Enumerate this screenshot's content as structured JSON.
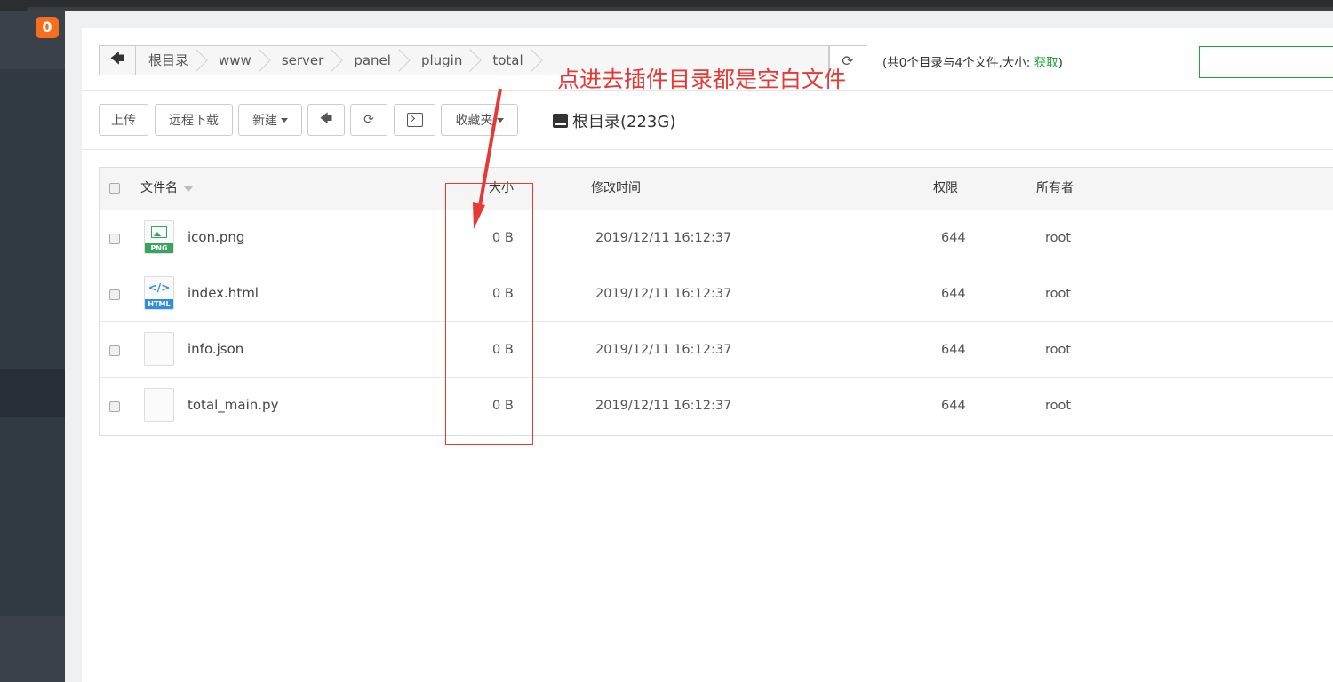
{
  "sidebar": {
    "badge_count": "0"
  },
  "path": {
    "crumbs": [
      "根目录",
      "www",
      "server",
      "panel",
      "plugin",
      "total"
    ]
  },
  "summary": {
    "text": "(共0个目录与4个文件,大小: ",
    "fetch": "获取",
    "close": ")"
  },
  "toolbar": {
    "upload": "上传",
    "remote_download": "远程下载",
    "new": "新建",
    "favorites": "收藏夹",
    "disk": "根目录(223G)"
  },
  "table": {
    "headers": {
      "name": "文件名",
      "size": "大小",
      "mtime": "修改时间",
      "perm": "权限",
      "owner": "所有者"
    },
    "rows": [
      {
        "name": "icon.png",
        "icon": "png-file-icon",
        "size": "0 B",
        "mtime": "2019/12/11 16:12:37",
        "perm": "644",
        "owner": "root"
      },
      {
        "name": "index.html",
        "icon": "html-file-icon",
        "size": "0 B",
        "mtime": "2019/12/11 16:12:37",
        "perm": "644",
        "owner": "root"
      },
      {
        "name": "info.json",
        "icon": "blank-file-icon",
        "size": "0 B",
        "mtime": "2019/12/11 16:12:37",
        "perm": "644",
        "owner": "root"
      },
      {
        "name": "total_main.py",
        "icon": "blank-file-icon",
        "size": "0 B",
        "mtime": "2019/12/11 16:12:37",
        "perm": "644",
        "owner": "root"
      }
    ]
  },
  "file_icons": {
    "png": "PNG",
    "html": "HTML"
  },
  "annotation": {
    "text": "点进去插件目录都是空白文件",
    "color": "#e53935"
  },
  "colors": {
    "accent": "#20a53a",
    "badge": "#f96e1e",
    "sidebar": "#313a42"
  }
}
